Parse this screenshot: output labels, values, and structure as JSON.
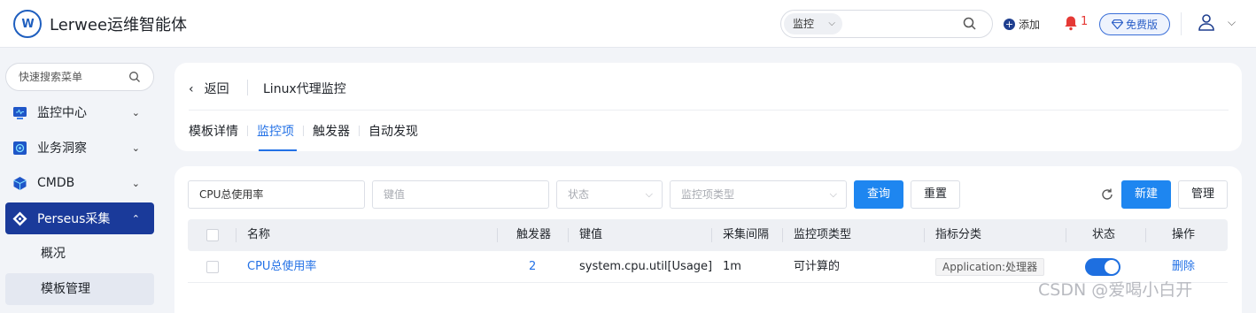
{
  "header": {
    "logo_text": "W",
    "brand": "Lerwee运维智能体",
    "search_category": "监控",
    "add_label": "添加",
    "alert_count": "1",
    "free_label": "免费版"
  },
  "sidebar": {
    "search_placeholder": "快速搜索菜单",
    "items": [
      {
        "label": "监控中心"
      },
      {
        "label": "业务洞察"
      },
      {
        "label": "CMDB"
      },
      {
        "label": "Perseus采集"
      }
    ],
    "subitems": [
      {
        "label": "概况"
      },
      {
        "label": "模板管理"
      }
    ]
  },
  "page": {
    "back_label": "返回",
    "title": "Linux代理监控",
    "tabs": [
      {
        "label": "模板详情"
      },
      {
        "label": "监控项"
      },
      {
        "label": "触发器"
      },
      {
        "label": "自动发现"
      }
    ]
  },
  "filters": {
    "name_value": "CPU总使用率",
    "key_placeholder": "键值",
    "status_placeholder": "状态",
    "type_placeholder": "监控项类型",
    "query_label": "查询",
    "reset_label": "重置",
    "new_label": "新建",
    "manage_label": "管理"
  },
  "table": {
    "columns": [
      "名称",
      "触发器",
      "键值",
      "采集间隔",
      "监控项类型",
      "指标分类",
      "状态",
      "操作"
    ],
    "rows": [
      {
        "name": "CPU总使用率",
        "triggers": "2",
        "key": "system.cpu.util[Usage]",
        "interval": "1m",
        "type": "可计算的",
        "category": "Application:处理器",
        "enabled": true,
        "action": "删除"
      }
    ]
  },
  "watermark": "CSDN @爱喝小白开",
  "colors": {
    "primary": "#1e86f0",
    "sidebar_active": "#1a3a9a",
    "link": "#2371e6",
    "alert": "#e53935"
  }
}
